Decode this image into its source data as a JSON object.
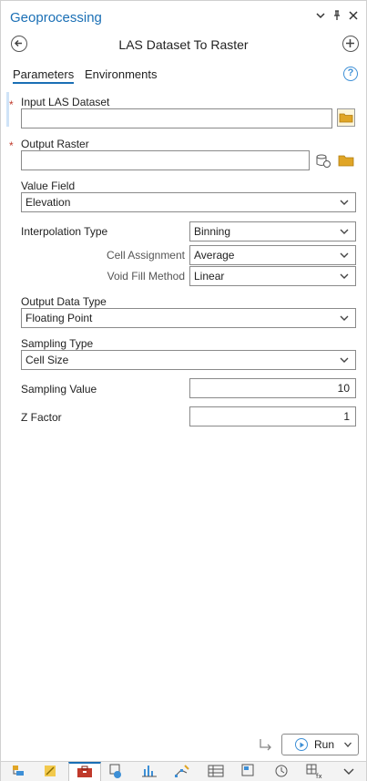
{
  "pane": {
    "title": "Geoprocessing",
    "tool_title": "LAS Dataset To Raster"
  },
  "tabs": [
    {
      "label": "Parameters",
      "active": true
    },
    {
      "label": "Environments",
      "active": false
    }
  ],
  "params": {
    "input_las": {
      "label": "Input LAS Dataset",
      "value": "",
      "required": "*"
    },
    "output_raster": {
      "label": "Output Raster",
      "value": "",
      "required": "*"
    },
    "value_field": {
      "label": "Value Field",
      "value": "Elevation"
    },
    "interp_type": {
      "label": "Interpolation Type",
      "value": "Binning"
    },
    "cell_assignment": {
      "label": "Cell Assignment",
      "value": "Average"
    },
    "void_fill": {
      "label": "Void Fill Method",
      "value": "Linear"
    },
    "output_type": {
      "label": "Output Data Type",
      "value": "Floating Point"
    },
    "sampling_type": {
      "label": "Sampling Type",
      "value": "Cell Size"
    },
    "sampling_value": {
      "label": "Sampling Value",
      "value": "10"
    },
    "z_factor": {
      "label": "Z Factor",
      "value": "1"
    }
  },
  "footer": {
    "run_label": "Run"
  },
  "colors": {
    "accent": "#1a6fb5",
    "required": "#c0392b",
    "folder": "#e0a526"
  },
  "bottom_tabs": [
    {
      "icon": "catalog-icon"
    },
    {
      "icon": "symbology-icon"
    },
    {
      "icon": "geoprocessing-toolbox-icon",
      "active": true
    },
    {
      "icon": "attribute-info-icon"
    },
    {
      "icon": "chart-icon"
    },
    {
      "icon": "edit-vertices-icon"
    },
    {
      "icon": "table-icon"
    },
    {
      "icon": "layout-icon"
    },
    {
      "icon": "history-icon"
    },
    {
      "icon": "calculate-field-icon"
    },
    {
      "icon": "more-chevron-icon"
    }
  ]
}
